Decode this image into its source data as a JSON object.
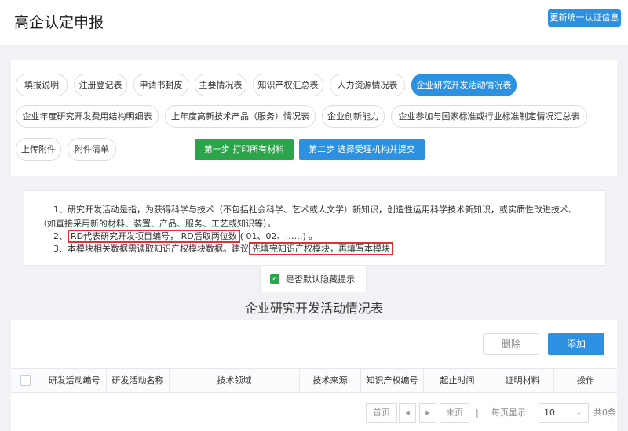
{
  "header": {
    "title": "高企认定申报",
    "update_button": "更新统一认证信息"
  },
  "tabs": {
    "items": [
      {
        "label": "填报说明"
      },
      {
        "label": "注册登记表"
      },
      {
        "label": "申请书封皮"
      },
      {
        "label": "主要情况表"
      },
      {
        "label": "知识产权汇总表"
      },
      {
        "label": "人力资源情况表"
      },
      {
        "label": "企业研究开发活动情况表",
        "active": true
      },
      {
        "label": "企业年度研究开发费用结构明细表"
      },
      {
        "label": "上年度高新技术产品（服务）情况表"
      },
      {
        "label": "企业创新能力"
      },
      {
        "label": "企业参加与国家标准或行业标准制定情况汇总表"
      },
      {
        "label": "上传附件"
      },
      {
        "label": "附件清单"
      }
    ],
    "step1": "第一步 打印所有材料",
    "step2": "第二步 选择受理机构并提交"
  },
  "notice": {
    "line1": "1、研究开发活动是指，为获得科学与技术（不包括社会科学、艺术或人文学）新知识，创造性运用科学技术新知识，或实质性改进技术、",
    "line1b": "（如直接采用新的材料、装置、产品、服务、工艺或知识等）。",
    "line2_prefix": "2、",
    "line2_highlight": "RD代表研究开发项目编号， RD后取两位数",
    "line2_suffix": "( 01、02、……) 。",
    "line3_prefix": "3、本模块相关数据需读取知识产权模块数据。建议",
    "line3_highlight": "先填完知识产权模块，再填写本模块"
  },
  "hide_toggle": {
    "checked": true,
    "label": "是否默认隐藏提示"
  },
  "table": {
    "title": "企业研究开发活动情况表",
    "delete_label": "删除",
    "add_label": "添加",
    "columns": [
      "研发活动编号",
      "研发活动名称",
      "技术领域",
      "技术来源",
      "知识产权编号",
      "起止时间",
      "证明材料",
      "操作"
    ]
  },
  "pagination": {
    "first": "首页",
    "prev_icon": "◂",
    "next_icon": "▸",
    "last": "末页",
    "separator": "|",
    "per_page_label": "每页显示",
    "per_page_value": "10",
    "total": "共0条"
  },
  "colors": {
    "primary": "#2b91e0",
    "success": "#2aa54a",
    "highlight": "#e03131"
  }
}
